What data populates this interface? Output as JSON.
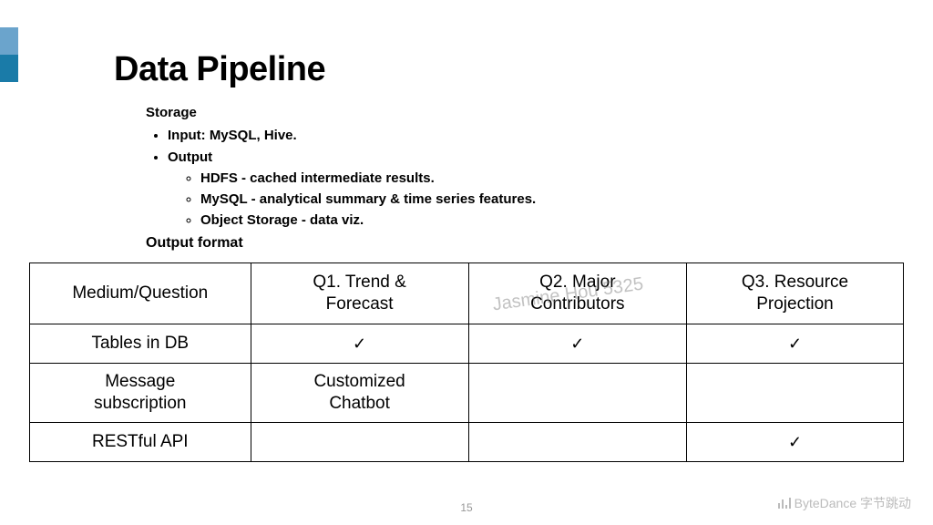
{
  "title": "Data Pipeline",
  "storage": {
    "heading": "Storage",
    "input": "Input: MySQL, Hive.",
    "output_label": "Output",
    "outputs": [
      "HDFS - cached intermediate results.",
      "MySQL - analytical summary & time series features.",
      "Object Storage - data viz."
    ]
  },
  "output_format_label": "Output format",
  "table": {
    "headers": [
      "Medium/Question",
      "Q1. Trend & Forecast",
      "Q2. Major Contributors",
      "Q3. Resource Projection"
    ],
    "rows": [
      {
        "label": "Tables in DB",
        "cells": [
          "✓",
          "✓",
          "✓"
        ]
      },
      {
        "label": "Message subscription",
        "cells": [
          "Customized Chatbot",
          "",
          ""
        ]
      },
      {
        "label": "RESTful API",
        "cells": [
          "",
          "",
          "✓"
        ]
      }
    ]
  },
  "watermark_user": "Jasmine Hou 5325",
  "page_number": "15",
  "brand": "ByteDance 字节跳动"
}
